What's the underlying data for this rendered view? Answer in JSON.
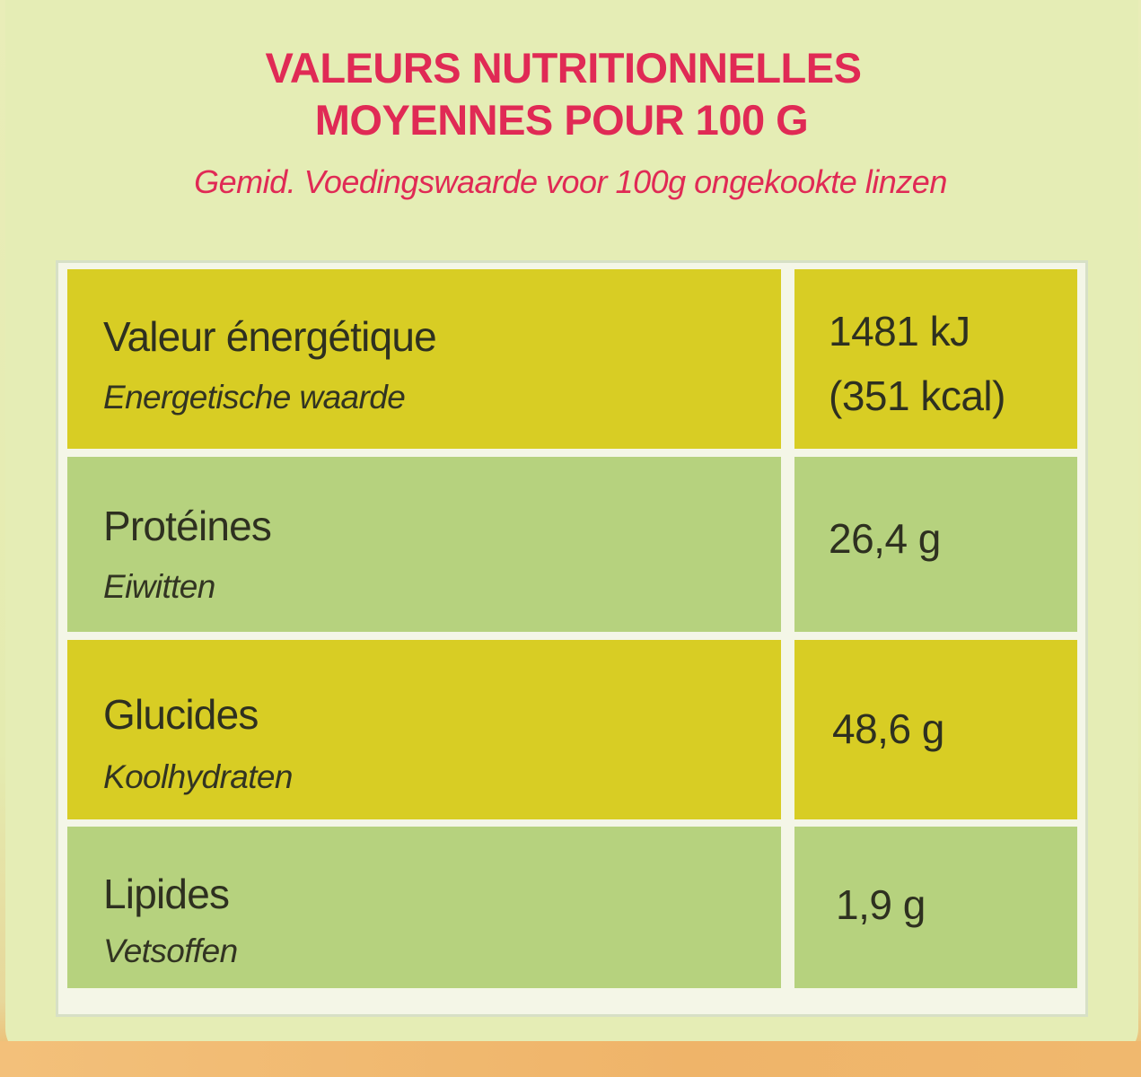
{
  "header": {
    "title_line1": "VALEURS NUTRITIONNELLES",
    "title_line2": "MOYENNES POUR 100 G",
    "subtitle": "Gemid. Voedingswaarde voor 100g ongekookte linzen"
  },
  "rows": [
    {
      "label_fr": "Valeur énergétique",
      "label_nl": "Energetische waarde",
      "value_line1": "1481 kJ",
      "value_line2": "(351 kcal)",
      "color": "#d8cd24"
    },
    {
      "label_fr": "Protéines",
      "label_nl": "Eiwitten",
      "value_line1": "26,4 g",
      "color": "#b6d27e"
    },
    {
      "label_fr": "Glucides",
      "label_nl": "Koolhydraten",
      "value_line1": "48,6 g",
      "color": "#d8cd24"
    },
    {
      "label_fr": "Lipides",
      "label_nl": "Vetsoffen",
      "value_line1": "1,9 g",
      "color": "#b6d27e"
    }
  ],
  "colors": {
    "title": "#e02a55",
    "background": "#e5edb5",
    "row_yellow": "#d8cd24",
    "row_green": "#b6d27e"
  }
}
